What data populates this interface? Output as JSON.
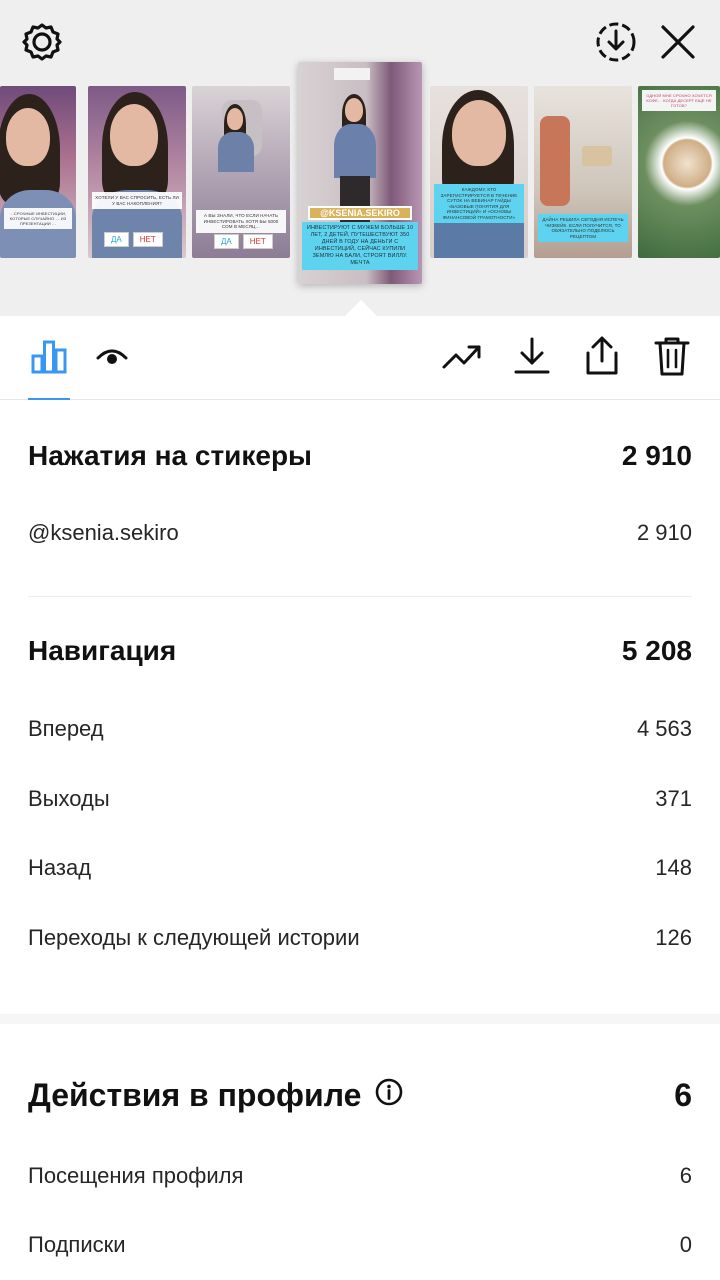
{
  "header": {
    "icons": {
      "settings": "settings-gear-icon",
      "save": "download-circle-icon",
      "close": "close-icon"
    }
  },
  "story_strip": {
    "thumbnails": [
      {
        "caption": "…СРОЧНЫЕ ИНВЕСТИЦИИ, КОТОРЫЕ СЛУЧАЙНО … ИЗ ПРЕЗЕНТАЦИИ …"
      },
      {
        "caption": "ХОТЕЛИ У ВАС СПРОСИТЬ, ЕСТЬ ЛИ У ВАС НАКОПЛЕНИЯ?",
        "btn_yes": "ДА",
        "btn_no": "НЕТ"
      },
      {
        "caption": "А ВЫ ЗНАЛИ, ЧТО ЕСЛИ НАЧАТЬ ИНВЕСТИРОВАТЬ ХОТЯ БЫ 5000 СОМ В МЕСЯЦ…",
        "btn_yes": "ДА",
        "btn_no": "НЕТ"
      },
      {
        "handle": "@KSENIA.SEKIRO",
        "caption": "ИНВЕСТИРУЮТ С МУЖЕМ БОЛЬШЕ 10 ЛЕТ, 2 ДЕТЕЙ, ПУТЕШЕСТВУЮТ 350 ДНЕЙ В ГОДУ НА ДЕНЬГИ С ИНВЕСТИЦИЙ, СЕЙЧАС КУПИЛИ ЗЕМЛЮ НА БАЛИ, СТРОЯТ ВИЛЛУ. МЕЧТА"
      },
      {
        "caption": "КАЖДОМУ, КТО ЗАРЕГИСТРИРУЕТСЯ В ТЕЧЕНИЕ СУТОК НА ВЕБИНАР ГАЙДЫ «БАЗОВЫЕ ПОНЯТИЯ ДЛЯ ИНВЕСТИЦИЙ» И «ОСНОВЫ ФИНАНСОВОЙ ГРАМОТНОСТИ»"
      },
      {
        "caption": "ДАЙНА РЕШИЛА СЕГОДНЯ ИСПЕЧЬ ЧИЗКЕЙК. ЕСЛИ ПОЛУЧИТСЯ, ТО ОБЯЗАТЕЛЬНО ПОДЕЛЮСЬ РЕЦЕПТОМ"
      },
      {
        "caption": "ОДНОЙ МНЕ СРОЧНО ХОЧЕТСЯ КОФЕ… КОГДА ДЕСЕРТ ЕЩЁ НЕ ГОТОВ?"
      }
    ]
  },
  "toolbar": {
    "tabs": [
      {
        "icon": "bar-chart-icon",
        "active": true
      },
      {
        "icon": "eye-icon",
        "active": false
      }
    ],
    "actions": [
      "trending-up-icon",
      "download-icon",
      "share-icon",
      "trash-icon"
    ],
    "accent_color": "#3897f0"
  },
  "stats": {
    "stickers": {
      "title": "Нажатия на стикеры",
      "total": "2 910",
      "items": [
        {
          "label": "@ksenia.sekiro",
          "value": "2 910"
        }
      ]
    },
    "navigation": {
      "title": "Навигация",
      "total": "5 208",
      "items": [
        {
          "label": "Вперед",
          "value": "4 563"
        },
        {
          "label": "Выходы",
          "value": "371"
        },
        {
          "label": "Назад",
          "value": "148"
        },
        {
          "label": "Переходы к следующей истории",
          "value": "126"
        }
      ]
    },
    "profile_actions": {
      "title": "Действия в профиле",
      "total": "6",
      "info_icon": "info-icon",
      "items": [
        {
          "label": "Посещения профиля",
          "value": "6"
        },
        {
          "label": "Подписки",
          "value": "0"
        }
      ]
    }
  }
}
